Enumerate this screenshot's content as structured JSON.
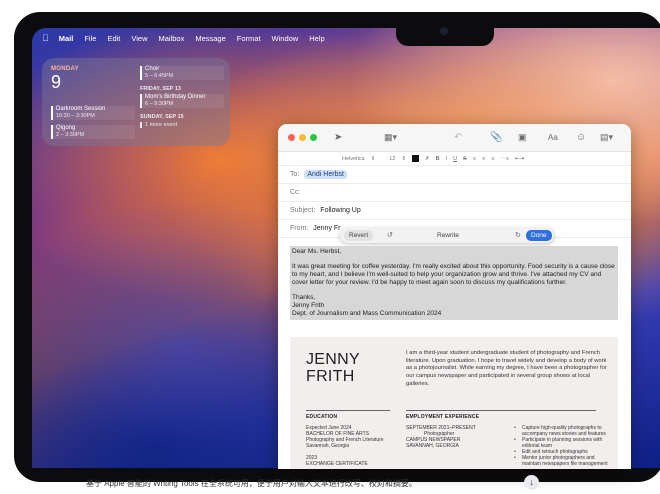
{
  "menubar": {
    "apple": "",
    "app": "Mail",
    "items": [
      "File",
      "Edit",
      "View",
      "Mailbox",
      "Message",
      "Format",
      "Window",
      "Help"
    ]
  },
  "widget": {
    "day_label": "MONDAY",
    "day_num": "9",
    "events_left": [
      {
        "title": "Darkroom Session",
        "time": "10:30 – 3:30PM"
      },
      {
        "title": "Qigong",
        "time": "2 – 3:30PM"
      }
    ],
    "event_right_top": {
      "title": "Choir",
      "time": "5 – 6:45PM"
    },
    "fri_head": "FRIDAY, SEP 13",
    "fri_event": {
      "title": "Mom's Birthday Dinner",
      "time": "6 – 9:30PM"
    },
    "sun_head": "SUNDAY, SEP 15",
    "sun_more": "1 more event"
  },
  "toolbar": {
    "icons": [
      "send-icon",
      "header-fields-icon",
      "reply-icon",
      "attachment-icon",
      "photo-browser-icon",
      "font-icon",
      "emoji-icon",
      "photo-icon"
    ]
  },
  "format": {
    "font": "Helvetica",
    "size": "12",
    "bold": "B",
    "italic": "I",
    "underline": "U",
    "strike": "S"
  },
  "fields": {
    "to_label": "To:",
    "to_value": "Andi Herbst",
    "cc_label": "Cc:",
    "subject_label": "Subject:",
    "subject_value": "Following Up",
    "from_label": "From:",
    "from_value": "Jenny Fr"
  },
  "rewrite_bar": {
    "revert": "Revert",
    "label": "Rewrite",
    "done": "Done"
  },
  "body": {
    "greeting": "Dear Ms. Herbst,",
    "para": "It was great meeting for coffee yesterday. I'm really excited about this opportunity. Food security is a cause close to my heart, and I believe I'm well-suited to help your organization grow and thrive. I've attached my CV and cover letter for your review. I'd be happy to meet again soon to discuss my qualifications further.",
    "sig1": "Thanks,",
    "sig2": "Jenny Frith",
    "sig3": "Dept. of Journalism and Mass Communication 2024"
  },
  "resume": {
    "name1": "JENNY",
    "name2": "FRITH",
    "bio": "I am a third-year student undergraduate student of photography and French literature. Upon graduation, I hope to travel widely and develop a body of work as a photojournalist. While earning my degree, I have been a photographer for our campus newspaper and participated in several group shows at local galleries.",
    "edu_head": "EDUCATION",
    "edu_lines": [
      "Expected June 2024",
      "BACHELOR OF FINE ARTS",
      "Photography and French Literature",
      "Savannah, Georgia",
      "",
      "2023",
      "EXCHANGE CERTIFICATE"
    ],
    "emp_head": "EMPLOYMENT EXPERIENCE",
    "emp_lines": [
      "SEPTEMBER 2021–PRESENT",
      "Photographer",
      "CAMPUS NEWSPAPER",
      "SAVANNAH, GEORGIA"
    ],
    "emp_bullets": [
      "Capture high-quality photographs to accompany news stories and features",
      "Participate in planning sessions with editorial team",
      "Edit and retouch photographs",
      "Mentor junior photographers and maintain newspapers file management"
    ]
  },
  "caption": "基于 Apple 智能的 Writing Tools 在全系统可用，便于用户对输入文本进行改写、校对和摘要。",
  "colors": {
    "accent": "#2f6fe0",
    "close": "#ff5f57",
    "min": "#febc2e",
    "max": "#28c840"
  }
}
